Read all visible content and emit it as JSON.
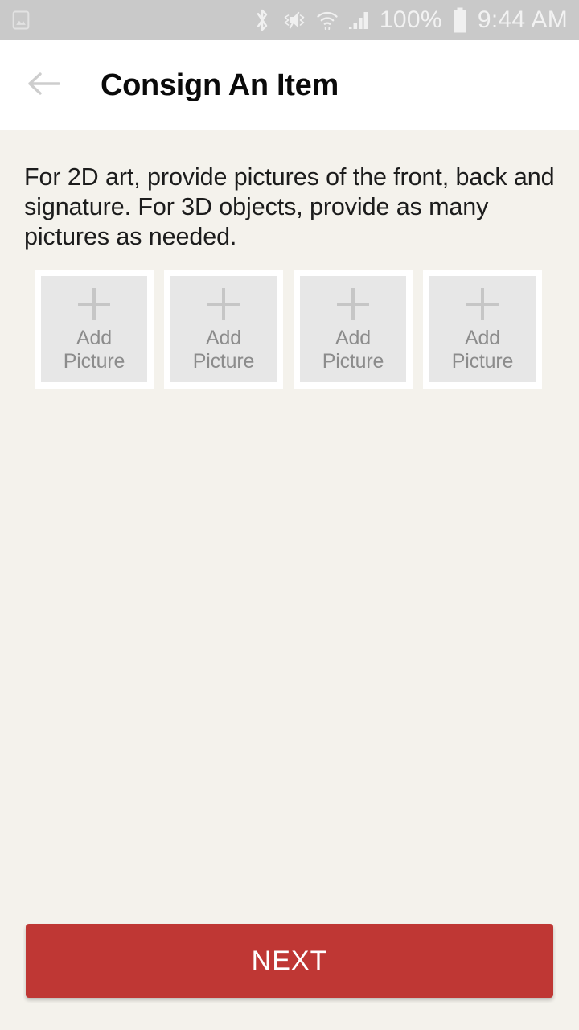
{
  "statusbar": {
    "left_icons": [
      {
        "name": "photo-icon",
        "label": "photo"
      }
    ],
    "right_icons": [
      {
        "name": "bluetooth-icon",
        "label": "bluetooth"
      },
      {
        "name": "mute-vibrate-icon",
        "label": "sound off / vibrate"
      },
      {
        "name": "wifi-icon",
        "label": "wifi"
      },
      {
        "name": "cellular-signal-icon",
        "label": "cellular signal"
      }
    ],
    "battery_percent": "100%",
    "time": "9:44 AM",
    "background_color": "#C9C9C9",
    "foreground_color": "#F2F2F2"
  },
  "header": {
    "back_label": "Back",
    "title": "Consign An Item",
    "background_color": "#FFFFFF",
    "title_color": "#0A0A0A"
  },
  "main": {
    "instructions": "For 2D art, provide pictures of the front, back and signature. For 3D objects, provide as many pictures as needed.",
    "picture_slots": [
      {
        "label": "Add\nPicture",
        "line1": "Add",
        "line2": "Picture",
        "filled": false
      },
      {
        "label": "Add\nPicture",
        "line1": "Add",
        "line2": "Picture",
        "filled": false
      },
      {
        "label": "Add\nPicture",
        "line1": "Add",
        "line2": "Picture",
        "filled": false
      },
      {
        "label": "Add\nPicture",
        "line1": "Add",
        "line2": "Picture",
        "filled": false
      }
    ],
    "background_color": "#F4F2EC"
  },
  "footer": {
    "next_label": "NEXT",
    "next_color": "#BF3734",
    "next_text_color": "#FFFFFF"
  }
}
